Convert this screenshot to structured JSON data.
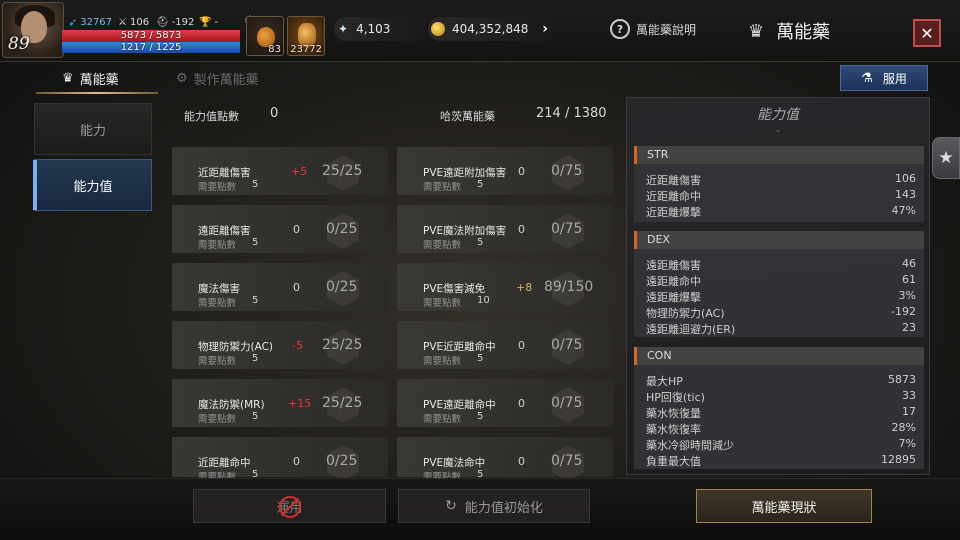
{
  "player": {
    "level": "89",
    "combat_power": "32767",
    "attack": "106",
    "defense": "-192",
    "trophy": "-",
    "hp_text": "5873 / 5873",
    "mp_text": "1217 / 1225"
  },
  "items": [
    {
      "count": "83",
      "icon": "potion-icon"
    },
    {
      "count": "23772",
      "icon": "elixir-icon"
    }
  ],
  "currency": {
    "gems": "4,103",
    "gold": "404,352,848"
  },
  "header": {
    "help_label": "萬能藥說明",
    "title": "萬能藥",
    "close_icon": "close-icon"
  },
  "tabs": [
    {
      "label": "萬能藥",
      "active": true
    },
    {
      "label": "製作萬能藥",
      "active": false
    }
  ],
  "use_button": "服用",
  "sidebar": [
    {
      "label": "能力",
      "active": false
    },
    {
      "label": "能力值",
      "active": true
    }
  ],
  "summary": {
    "points_label": "能力值點數",
    "points_value": "0",
    "elixir_label": "哈茨萬能藥",
    "elixir_value": "214 / 1380"
  },
  "stats_left": [
    {
      "name": "近距離傷害",
      "needed_label": "需要點數",
      "needed": "5",
      "bonus": "+5",
      "value": "25/25"
    },
    {
      "name": "遠距離傷害",
      "needed_label": "需要點數",
      "needed": "5",
      "bonus": "0",
      "value": "0/25"
    },
    {
      "name": "魔法傷害",
      "needed_label": "需要點數",
      "needed": "5",
      "bonus": "0",
      "value": "0/25"
    },
    {
      "name": "物理防禦力(AC)",
      "needed_label": "需要點數",
      "needed": "5",
      "bonus": "-5",
      "value": "25/25"
    },
    {
      "name": "魔法防禦(MR)",
      "needed_label": "需要點數",
      "needed": "5",
      "bonus": "+15",
      "value": "25/25"
    },
    {
      "name": "近距離命中",
      "needed_label": "需要點數",
      "needed": "5",
      "bonus": "0",
      "value": "0/25"
    }
  ],
  "stats_right": [
    {
      "name": "PVE遠距附加傷害",
      "needed_label": "需要點數",
      "needed": "5",
      "bonus": "0",
      "value": "0/75"
    },
    {
      "name": "PVE魔法附加傷害",
      "needed_label": "需要點數",
      "needed": "5",
      "bonus": "0",
      "value": "0/75"
    },
    {
      "name": "PVE傷害減免",
      "needed_label": "需要點數",
      "needed": "10",
      "bonus": "+8",
      "value": "89/150"
    },
    {
      "name": "PVE近距離命中",
      "needed_label": "需要點數",
      "needed": "5",
      "bonus": "0",
      "value": "0/75"
    },
    {
      "name": "PVE遠距離命中",
      "needed_label": "需要點數",
      "needed": "5",
      "bonus": "0",
      "value": "0/75"
    },
    {
      "name": "PVE魔法命中",
      "needed_label": "需要點數",
      "needed": "5",
      "bonus": "0",
      "value": "0/75"
    }
  ],
  "right_panel": {
    "title": "能力值",
    "sections": [
      {
        "header": "STR",
        "rows": [
          {
            "label": "近距離傷害",
            "value": "106"
          },
          {
            "label": "近距離命中",
            "value": "143"
          },
          {
            "label": "近距離爆擊",
            "value": "47%"
          }
        ]
      },
      {
        "header": "DEX",
        "rows": [
          {
            "label": "遠距離傷害",
            "value": "46"
          },
          {
            "label": "遠距離命中",
            "value": "61"
          },
          {
            "label": "遠距離爆擊",
            "value": "3%"
          },
          {
            "label": "物理防禦力(AC)",
            "value": "-192"
          },
          {
            "label": "遠距離迴避力(ER)",
            "value": "23"
          }
        ]
      },
      {
        "header": "CON",
        "rows": [
          {
            "label": "最大HP",
            "value": "5873"
          },
          {
            "label": "HP回復(tic)",
            "value": "33"
          },
          {
            "label": "藥水恢復量",
            "value": "17"
          },
          {
            "label": "藥水恢復率",
            "value": "28%"
          },
          {
            "label": "藥水冷卻時間減少",
            "value": "7%"
          },
          {
            "label": "負重最大值",
            "value": "12895"
          }
        ]
      }
    ]
  },
  "bottom": {
    "apply_label": "運用",
    "reset_label": "能力值初始化",
    "status_label": "萬能藥現狀"
  }
}
